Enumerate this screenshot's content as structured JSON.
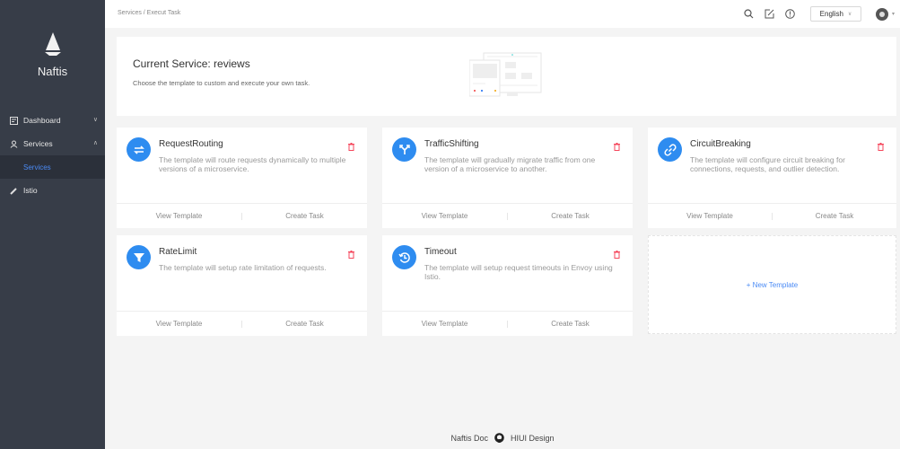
{
  "app": {
    "name": "Naftis"
  },
  "sidebar": {
    "items": [
      {
        "label": "Dashboard",
        "icon": "dashboard-icon",
        "expanded": false
      },
      {
        "label": "Services",
        "icon": "services-icon",
        "expanded": true,
        "children": [
          {
            "label": "Services",
            "active": true
          }
        ]
      },
      {
        "label": "Istio",
        "icon": "istio-icon"
      }
    ]
  },
  "topbar": {
    "breadcrumb": "Services / Execut Task",
    "icons": [
      "search-icon",
      "edit-icon",
      "info-icon"
    ],
    "language": "English",
    "avatar": "avatar"
  },
  "header": {
    "title": "Current Service: reviews",
    "description": "Choose the template to custom and execute your own task."
  },
  "templates": [
    {
      "title": "RequestRouting",
      "icon": "swap-icon",
      "description": "The template will route requests dynamically to multiple versions of a microservice.",
      "view_label": "View Template",
      "create_label": "Create Task"
    },
    {
      "title": "TrafficShifting",
      "icon": "fork-icon",
      "description": "The template will gradually migrate traffic from one version of a microservice to another.",
      "view_label": "View Template",
      "create_label": "Create Task"
    },
    {
      "title": "CircuitBreaking",
      "icon": "link-icon",
      "description": "The template will configure circuit breaking for connections, requests, and outlier detection.",
      "view_label": "View Template",
      "create_label": "Create Task"
    },
    {
      "title": "RateLimit",
      "icon": "filter-icon",
      "description": "The template will setup rate limitation of requests.",
      "view_label": "View Template",
      "create_label": "Create Task"
    },
    {
      "title": "Timeout",
      "icon": "history-icon",
      "description": "The template will setup request timeouts in Envoy using Istio.",
      "view_label": "View Template",
      "create_label": "Create Task"
    }
  ],
  "new_template_label": "+ New Template",
  "footer": {
    "doc_label": "Naftis Doc",
    "design_label": "HIUI Design"
  },
  "colors": {
    "accent": "#2e8cf0",
    "link": "#4b8bf5",
    "delete": "#f5475c",
    "sidebar": "#373d48"
  }
}
